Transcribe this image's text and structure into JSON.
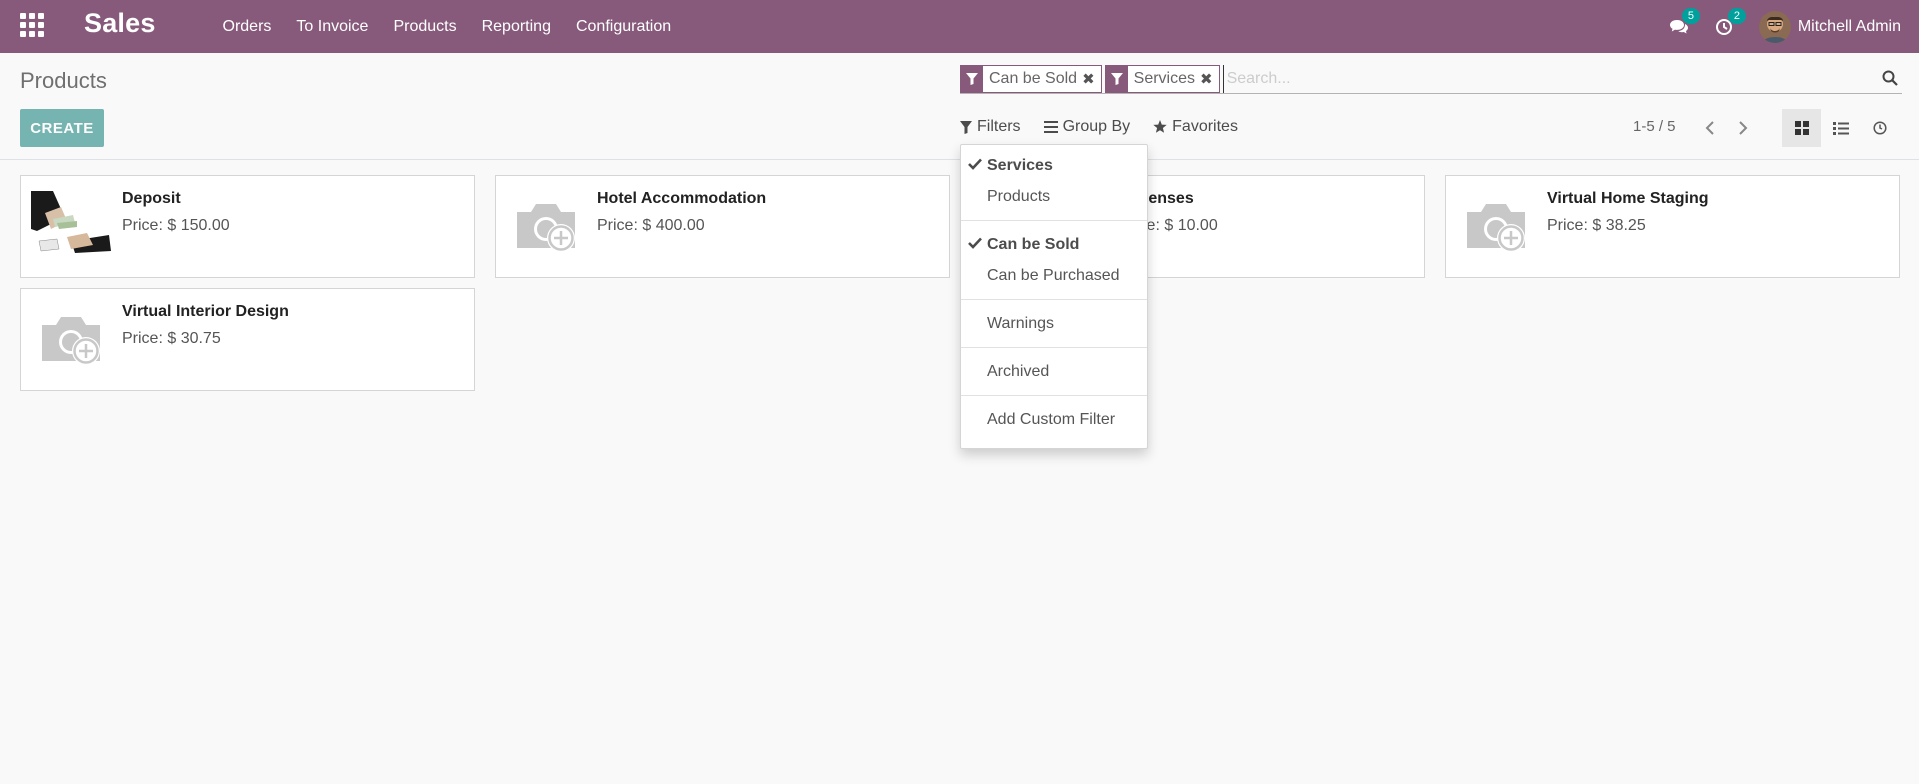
{
  "navbar": {
    "brand": "Sales",
    "menu": [
      "Orders",
      "To Invoice",
      "Products",
      "Reporting",
      "Configuration"
    ],
    "messages_count": "5",
    "activities_count": "2",
    "user_name": "Mitchell Admin"
  },
  "control_panel": {
    "breadcrumb": "Products",
    "create_label": "CREATE",
    "search": {
      "facets": [
        "Can be Sold",
        "Services"
      ],
      "placeholder": "Search..."
    },
    "filters_label": "Filters",
    "group_by_label": "Group By",
    "favorites_label": "Favorites",
    "pager": "1-5 / 5"
  },
  "filters_dropdown": {
    "group1": [
      {
        "label": "Services",
        "selected": true
      },
      {
        "label": "Products",
        "selected": false
      }
    ],
    "group2": [
      {
        "label": "Can be Sold",
        "selected": true
      },
      {
        "label": "Can be Purchased",
        "selected": false
      }
    ],
    "group3": [
      {
        "label": "Warnings",
        "selected": false
      }
    ],
    "group4": [
      {
        "label": "Archived",
        "selected": false
      }
    ],
    "custom_filter": "Add Custom Filter"
  },
  "products": [
    {
      "name": "Deposit",
      "price": "Price: $ 150.00"
    },
    {
      "name": "Hotel Accommodation",
      "price": "Price: $ 400.00"
    },
    {
      "name": "Expenses",
      "price": "Price: $ 10.00"
    },
    {
      "name": "Virtual Home Staging",
      "price": "Price: $ 38.25"
    },
    {
      "name": "Virtual Interior Design",
      "price": "Price: $ 30.75"
    }
  ],
  "colors": {
    "brand": "#875a7b",
    "accent": "#00a09d"
  }
}
